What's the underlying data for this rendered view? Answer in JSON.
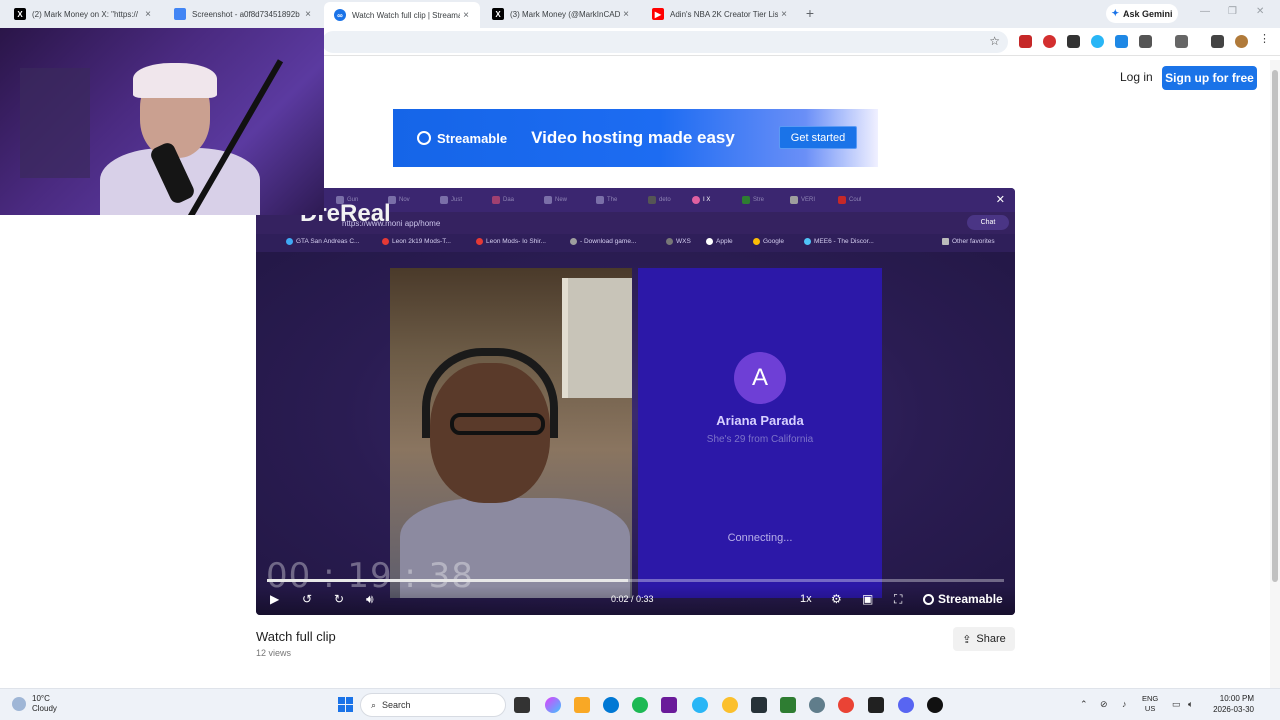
{
  "browser": {
    "tabs": [
      {
        "title": "(2) Mark Money on X: \"https://",
        "icon": "x-icon",
        "color": "#000000"
      },
      {
        "title": "Screenshot - a0f8d73451892b",
        "icon": "screenshot-icon",
        "color": "#4285f4"
      },
      {
        "title": "Watch Watch full clip | Streama",
        "icon": "streamable-icon",
        "color": "#1a73e8"
      },
      {
        "title": "(3) Mark Money (@MarkInCAD",
        "icon": "x-icon",
        "color": "#000000"
      },
      {
        "title": "Adin's NBA 2K Creator Tier List",
        "icon": "youtube-icon",
        "color": "#ff0000"
      }
    ],
    "ask_gemini": "Ask Gemini",
    "new_tab": "+"
  },
  "header": {
    "login": "Log in",
    "signup": "Sign up for free"
  },
  "banner": {
    "brand": "Streamable",
    "headline": "Video hosting made easy",
    "cta": "Get started"
  },
  "video": {
    "overlay_name": "DreReal",
    "inner_tabs": [
      "Gun",
      "Nov",
      "Just",
      "Daa",
      "New",
      "The",
      "deto",
      "I X",
      "Stre",
      "VERI",
      "Coul"
    ],
    "url": "https://www.moni app/home",
    "chat": "Chat",
    "bookmarks": [
      "GTA San Andreas C...",
      "Leon 2k19 Mods-T...",
      "Leon Mods- Io Shir...",
      "- Download game...",
      "WXS",
      "Apple",
      "Google",
      "MEE6 - The Discor...",
      "Other favorites"
    ],
    "avatar_letter": "A",
    "match_name": "Ariana Parada",
    "match_sub": "She's 29 from California",
    "status": "Connecting...",
    "timer": "00 : 19 : 38",
    "time_display": "0:02 / 0:33",
    "progress_fraction": 0.49,
    "speed": "1x",
    "brand": "Streamable"
  },
  "clip": {
    "title": "Watch full clip",
    "views": "12 views",
    "share": "Share"
  },
  "taskbar": {
    "weather_temp": "10°C",
    "weather_desc": "Cloudy",
    "search": "Search",
    "lang_top": "ENG",
    "lang_bottom": "US",
    "time": "10:00 PM",
    "date": "2026-03-30"
  }
}
